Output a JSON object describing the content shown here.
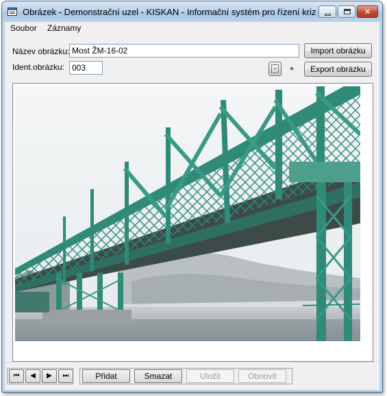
{
  "window": {
    "title": "Obrázek - Demonstrační uzel - KISKAN - Informační systém pro řízení krizových..."
  },
  "menu": {
    "items": [
      "Soubor",
      "Záznamy"
    ]
  },
  "form": {
    "name_label": "Název obrázku:",
    "name_value": "Most ŽM-16-02",
    "ident_label": "Ident.obrázku:",
    "ident_value": "003",
    "import_label": "Import obrázku",
    "export_label": "Export obrázku",
    "zoom_out_label": "-",
    "zoom_in_label": "+"
  },
  "navigation": {
    "first": "⏮",
    "prev": "◀",
    "next": "▶",
    "last": "⏭"
  },
  "actions": {
    "add": "Přidat",
    "delete": "Smazat",
    "save": "Uložit",
    "restore": "Obnovit",
    "save_enabled": false,
    "restore_enabled": false
  },
  "image": {
    "subject": "steel truss bridge over river"
  }
}
